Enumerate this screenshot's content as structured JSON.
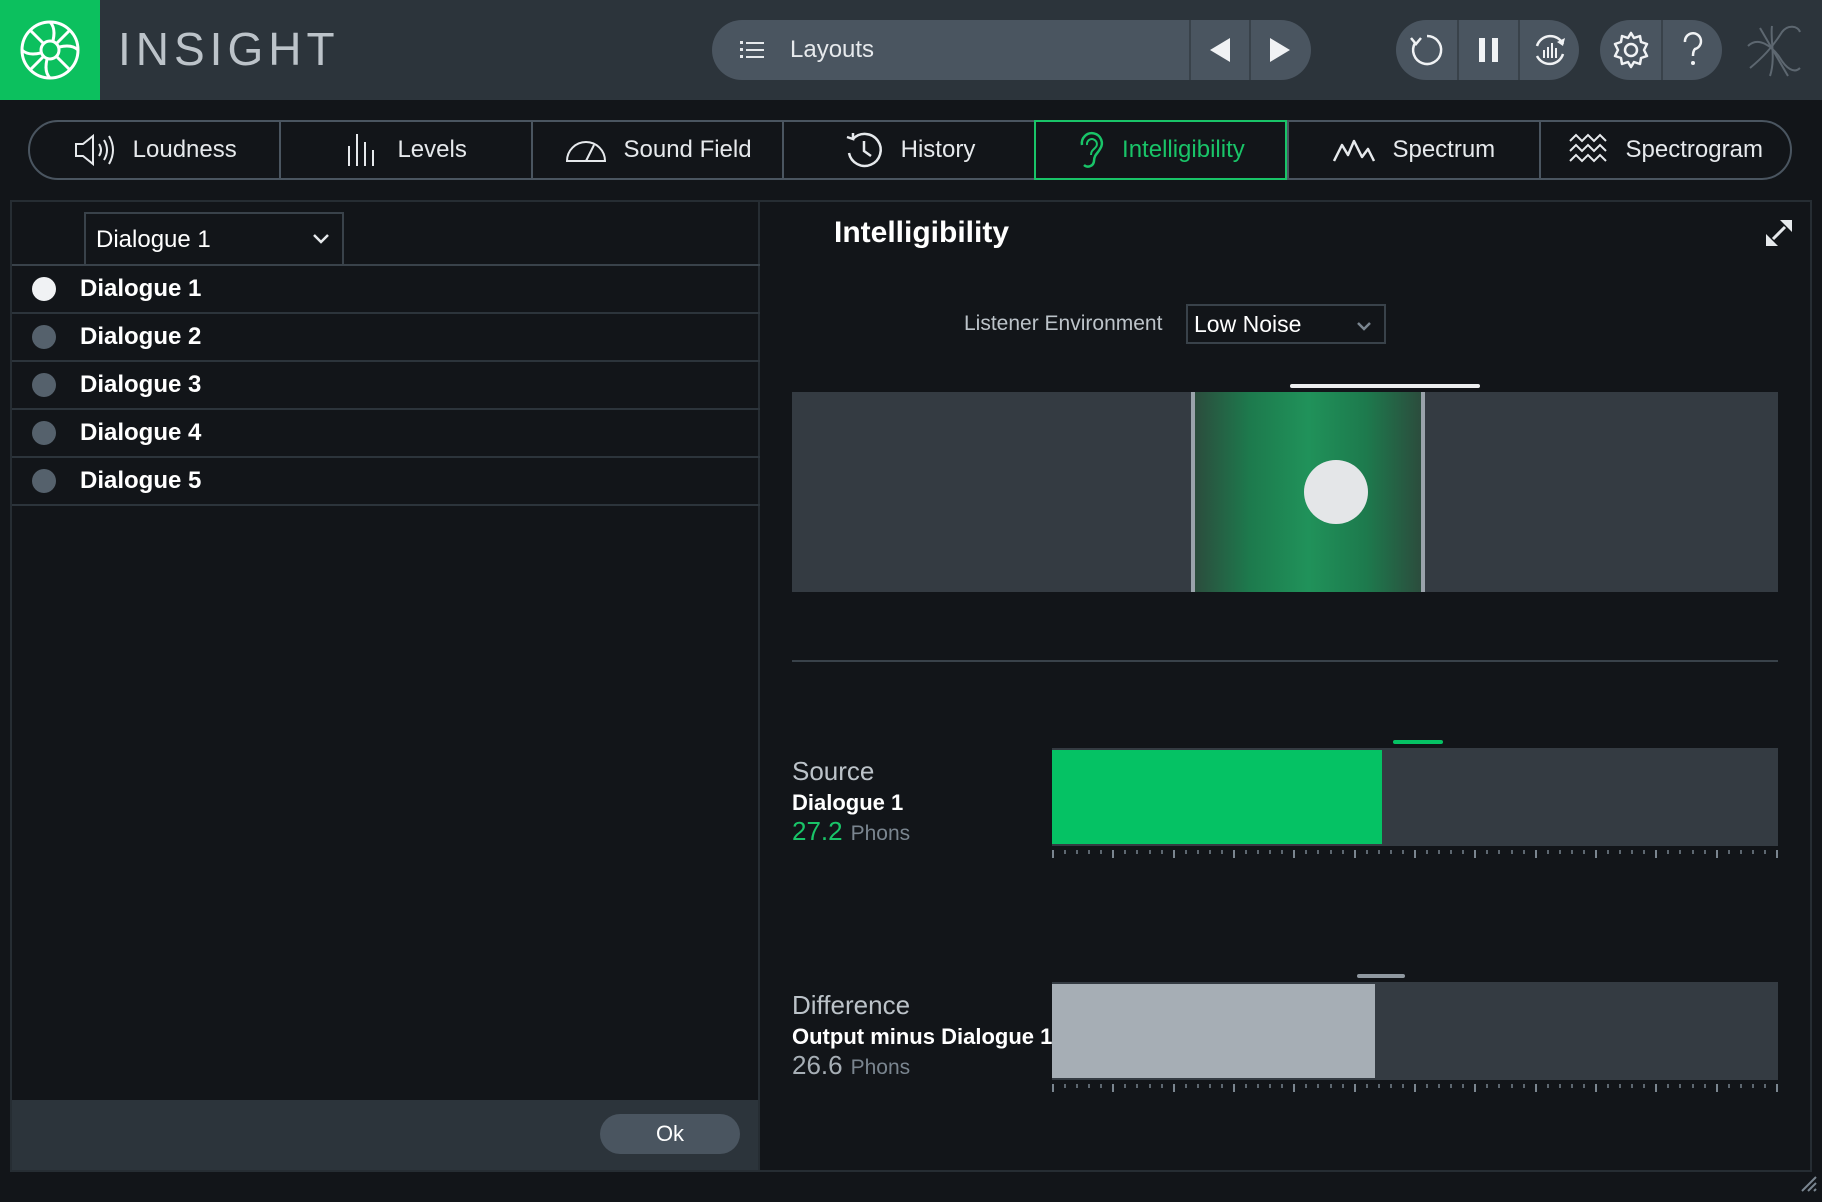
{
  "app": {
    "title": "INSIGHT"
  },
  "topbar": {
    "layouts_label": "Layouts"
  },
  "tabs": [
    {
      "label": "Loudness",
      "icon": "speaker-icon"
    },
    {
      "label": "Levels",
      "icon": "levels-icon"
    },
    {
      "label": "Sound Field",
      "icon": "gauge-icon"
    },
    {
      "label": "History",
      "icon": "history-icon"
    },
    {
      "label": "Intelligibility",
      "icon": "ear-icon",
      "active": true
    },
    {
      "label": "Spectrum",
      "icon": "spectrum-icon"
    },
    {
      "label": "Spectrogram",
      "icon": "spectrogram-icon"
    }
  ],
  "left_panel": {
    "dropdown_value": "Dialogue 1",
    "items": [
      "Dialogue 1",
      "Dialogue 2",
      "Dialogue 3",
      "Dialogue 4",
      "Dialogue 5"
    ],
    "selected_index": 0,
    "ok_label": "Ok"
  },
  "right_panel": {
    "title": "Intelligibility",
    "env_label": "Listener Environment",
    "env_value": "Low Noise",
    "source": {
      "label": "Source",
      "name": "Dialogue 1",
      "value": "27.2",
      "unit": "Phons",
      "fill_fraction": 0.455,
      "peak_fraction": 0.47,
      "color": "#05c264"
    },
    "difference": {
      "label": "Difference",
      "name": "Output minus Dialogue 1",
      "value": "26.6",
      "unit": "Phons",
      "fill_fraction": 0.445,
      "peak_fraction": 0.42,
      "color": "#a6aeb5"
    }
  },
  "colors": {
    "accent": "#19c468",
    "topbar": "#2c343b",
    "background": "#121519"
  }
}
